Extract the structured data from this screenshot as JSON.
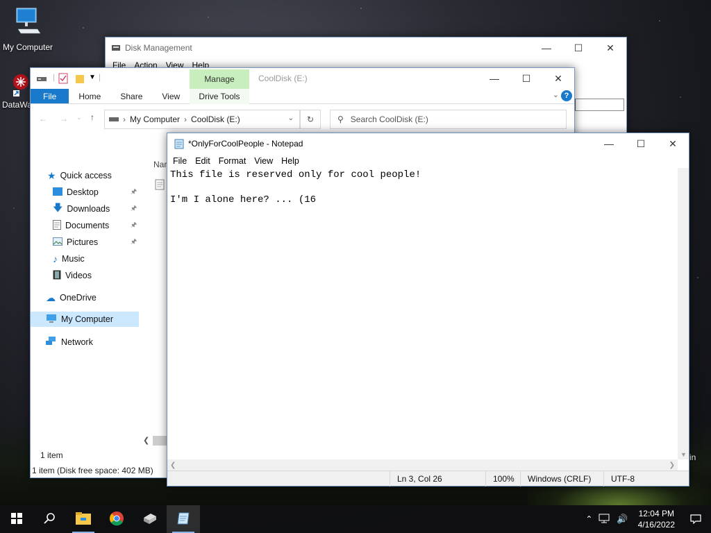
{
  "desktop": {
    "icons": [
      {
        "label": "My Computer",
        "icon": "computer-icon"
      },
      {
        "label": "DataWa",
        "icon": "datawarehouse-icon"
      }
    ],
    "partial_text": "in"
  },
  "disk_management": {
    "title": "Disk Management",
    "menu": [
      "File",
      "Action",
      "View",
      "Help"
    ]
  },
  "explorer": {
    "title": "CoolDisk (E:)",
    "ribbon": {
      "tabs": [
        "File",
        "Home",
        "Share",
        "View"
      ],
      "contextual_group": "Manage",
      "contextual_tab": "Drive Tools"
    },
    "address": {
      "crumbs": [
        "My Computer",
        "CoolDisk (E:)"
      ]
    },
    "search_placeholder": "Search CoolDisk (E:)",
    "column_header_partial": "Nar",
    "nav": {
      "quick_access": "Quick access",
      "items": [
        {
          "label": "Desktop",
          "icon": "desktop-folder-icon",
          "pinned": true
        },
        {
          "label": "Downloads",
          "icon": "downloads-folder-icon",
          "pinned": true
        },
        {
          "label": "Documents",
          "icon": "documents-folder-icon",
          "pinned": true
        },
        {
          "label": "Pictures",
          "icon": "pictures-folder-icon",
          "pinned": true
        },
        {
          "label": "Music",
          "icon": "music-folder-icon",
          "pinned": false
        },
        {
          "label": "Videos",
          "icon": "videos-folder-icon",
          "pinned": false
        }
      ],
      "onedrive": "OneDrive",
      "my_computer": "My Computer",
      "network": "Network"
    },
    "item_count": "1 item",
    "status": "1 item (Disk free space: 402 MB)"
  },
  "notepad": {
    "title": "*OnlyForCoolPeople - Notepad",
    "menu": [
      "File",
      "Edit",
      "Format",
      "View",
      "Help"
    ],
    "content": "This file is reserved only for cool people!\n\nI'm I alone here? ... (16",
    "status": {
      "position": "Ln 3, Col 26",
      "zoom": "100%",
      "line_endings": "Windows (CRLF)",
      "encoding": "UTF-8"
    }
  },
  "taskbar": {
    "time": "12:04 PM",
    "date": "4/16/2022",
    "apps": [
      "start-icon",
      "search-icon",
      "file-explorer-icon",
      "chrome-icon",
      "drive-app-icon",
      "notepad-icon"
    ]
  },
  "colors": {
    "accent": "#1979ca",
    "manage_tab": "#c7eebc",
    "nav_selected": "#cce8ff"
  }
}
